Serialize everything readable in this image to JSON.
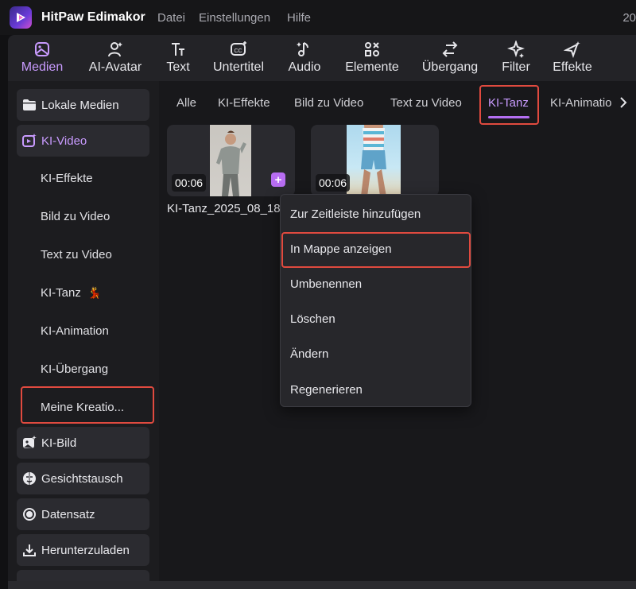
{
  "app": {
    "title": "HitPaw Edimakor",
    "menu": [
      "Datei",
      "Einstellungen",
      "Hilfe"
    ],
    "right_text": "20"
  },
  "toolbar": {
    "items": [
      {
        "label": "Medien",
        "icon": "media-icon"
      },
      {
        "label": "AI-Avatar",
        "icon": "avatar-icon"
      },
      {
        "label": "Text",
        "icon": "text-icon"
      },
      {
        "label": "Untertitel",
        "icon": "subtitle-icon"
      },
      {
        "label": "Audio",
        "icon": "audio-icon"
      },
      {
        "label": "Elemente",
        "icon": "elements-icon"
      },
      {
        "label": "Übergang",
        "icon": "transition-icon"
      },
      {
        "label": "Filter",
        "icon": "filter-icon"
      },
      {
        "label": "Effekte",
        "icon": "effects-icon"
      }
    ]
  },
  "sidebar": {
    "local_media": "Lokale Medien",
    "ki_video": "KI-Video",
    "sub_items": [
      "KI-Effekte",
      "Bild zu Video",
      "Text zu Video",
      "KI-Tanz",
      "KI-Animation",
      "KI-Übergang",
      "Meine Kreatio..."
    ],
    "dance_emoji": "💃",
    "ki_bild": "KI-Bild",
    "face_swap": "Gesichtstausch",
    "dataset": "Datensatz",
    "download": "Herunterzuladen"
  },
  "tabs": [
    "Alle",
    "KI-Effekte",
    "Bild zu Video",
    "Text zu Video",
    "KI-Tanz",
    "KI-Animatio"
  ],
  "cards": [
    {
      "duration": "00:06",
      "name": "KI-Tanz_2025_08_18"
    },
    {
      "duration": "00:06"
    }
  ],
  "context_menu": {
    "items": [
      "Zur Zeitleiste hinzufügen",
      "In Mappe anzeigen",
      "Umbenennen",
      "Löschen",
      "Ändern",
      "Regenerieren"
    ]
  },
  "colors": {
    "accent": "#c99bff",
    "highlight": "#e04a3f",
    "background": "#111113"
  }
}
